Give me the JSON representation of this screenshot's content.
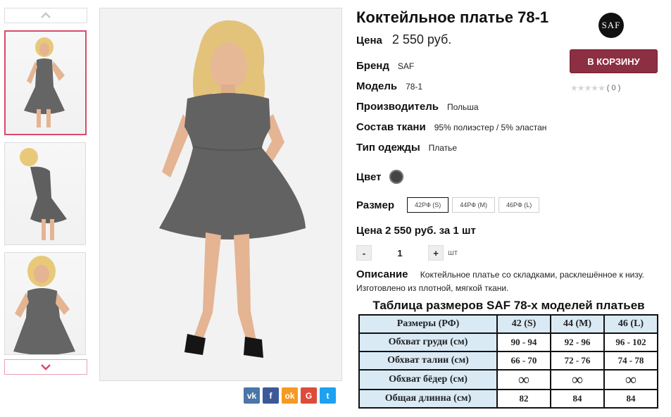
{
  "product": {
    "title": "Коктейльное платье 78-1",
    "price_label": "Цена",
    "price_value": "2 550 руб.",
    "properties": [
      {
        "label": "Бренд",
        "value": "SAF"
      },
      {
        "label": "Модель",
        "value": "78-1"
      },
      {
        "label": "Производитель",
        "value": "Польша"
      },
      {
        "label": "Состав ткани",
        "value": "95% полиэстер / 5% эластан"
      },
      {
        "label": "Тип одежды",
        "value": "Платье"
      }
    ],
    "color_label": "Цвет",
    "color_hex": "#444444",
    "size_label": "Размер",
    "sizes": [
      {
        "label": "42РФ (S)",
        "selected": true
      },
      {
        "label": "44РФ (M)",
        "selected": false
      },
      {
        "label": "46РФ (L)",
        "selected": false
      }
    ],
    "price_per_unit": "Цена 2 550 руб. за 1 шт",
    "quantity": {
      "minus": "-",
      "value": "1",
      "plus": "+",
      "unit": "шт"
    },
    "description_label": "Описание",
    "description_text": "Коктейльное платье со складками, расклешённое к низу. Изготовлено из плотной, мягкой ткани."
  },
  "brand_logo_text": "SAF",
  "cart_button": "В КОРЗИНУ",
  "rating": {
    "stars": "★★★★★",
    "count": "( 0 )"
  },
  "share_icons": [
    {
      "name": "vk",
      "glyph": "vk",
      "color": "#4a76a8"
    },
    {
      "name": "facebook",
      "glyph": "f",
      "color": "#3b5998"
    },
    {
      "name": "odnoklassniki",
      "glyph": "ok",
      "color": "#f59a23"
    },
    {
      "name": "google-plus",
      "glyph": "G",
      "color": "#dd4b39"
    },
    {
      "name": "twitter",
      "glyph": "t",
      "color": "#1da1f2"
    }
  ],
  "size_table": {
    "title": "Таблица размеров SAF 78-х моделей платьев",
    "header": [
      "Размеры (РФ)",
      "42 (S)",
      "44 (M)",
      "46 (L)"
    ],
    "rows": [
      [
        "Обхват груди (см)",
        "90 - 94",
        "92 - 96",
        "96 - 102"
      ],
      [
        "Обхват талии (см)",
        "66 - 70",
        "72 - 76",
        "74 - 78"
      ],
      [
        "Обхват бёдер (см)",
        "∞",
        "∞",
        "∞"
      ],
      [
        "Общая длинна (см)",
        "82",
        "84",
        "84"
      ]
    ]
  },
  "colors": {
    "accent": "#d94a6a",
    "cart": "#8c2f42",
    "table_cell": "#d9eaf5"
  }
}
